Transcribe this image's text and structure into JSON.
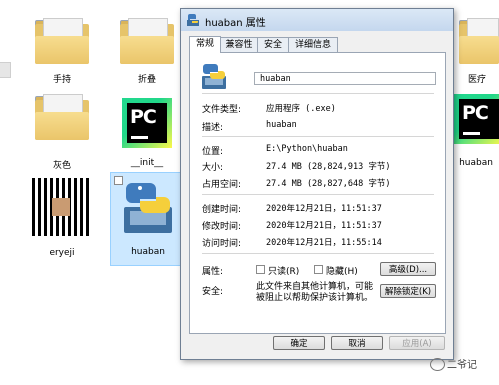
{
  "explorer": {
    "files": [
      {
        "label": "手持"
      },
      {
        "label": "折叠"
      },
      {
        "label": "医疗"
      },
      {
        "label": "灰色"
      },
      {
        "label": "__init__"
      },
      {
        "label": "huaban"
      },
      {
        "label": "eryeji"
      },
      {
        "label": "huaban"
      }
    ]
  },
  "dialog": {
    "title": "huaban 属性",
    "tabs": [
      "常规",
      "兼容性",
      "安全",
      "详细信息"
    ],
    "filename": "huaban",
    "fields": {
      "type_label": "文件类型:",
      "type_value": "应用程序 (.exe)",
      "desc_label": "描述:",
      "desc_value": "huaban",
      "location_label": "位置:",
      "location_value": "E:\\Python\\huaban",
      "size_label": "大小:",
      "size_value": "27.4 MB (28,824,913 字节)",
      "disk_label": "占用空间:",
      "disk_value": "27.4 MB (28,827,648 字节)",
      "created_label": "创建时间:",
      "created_value": "2020年12月21日，11:51:37",
      "modified_label": "修改时间:",
      "modified_value": "2020年12月21日，11:51:37",
      "accessed_label": "访问时间:",
      "accessed_value": "2020年12月21日，11:55:14",
      "attr_label": "属性:",
      "readonly_label": "只读(R)",
      "hidden_label": "隐藏(H)",
      "advanced_label": "高级(D)...",
      "security_label": "安全:",
      "security_text": "此文件来自其他计算机，可能被阻止以帮助保护该计算机。",
      "unblock_label": "解除锁定(K)"
    },
    "buttons": {
      "ok": "确定",
      "cancel": "取消",
      "apply": "应用(A)"
    }
  },
  "watermark": "二爷记"
}
